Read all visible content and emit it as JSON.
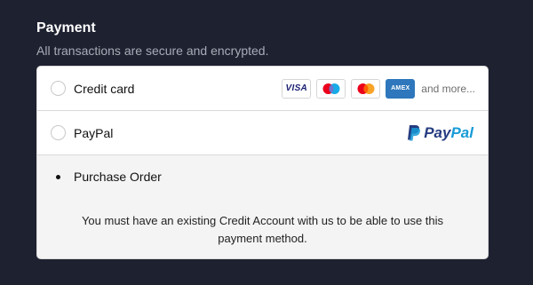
{
  "header": {
    "title": "Payment",
    "subtitle": "All transactions are secure and encrypted."
  },
  "options": [
    {
      "label": "Credit card",
      "selected": false,
      "cards": [
        {
          "name": "visa",
          "text": "VISA",
          "color": "#1a1f71"
        },
        {
          "name": "maestro",
          "text": "",
          "colors": [
            "#eb001b",
            "#00a2e5"
          ]
        },
        {
          "name": "mastercard",
          "text": "",
          "colors": [
            "#eb001b",
            "#f79e1b"
          ]
        },
        {
          "name": "amex",
          "text": "AMEX",
          "color": "#2e77bc"
        }
      ],
      "more": "and more..."
    },
    {
      "label": "PayPal",
      "selected": false,
      "brand": {
        "pay": "Pay",
        "pal": "Pal"
      }
    },
    {
      "label": "Purchase Order",
      "selected": true
    }
  ],
  "purchase_order_note": "You must have an existing Credit Account with us to be able to use this payment method.",
  "colors": {
    "background": "#1e2130",
    "paypal_dark": "#253b80",
    "paypal_light": "#179bd7"
  }
}
